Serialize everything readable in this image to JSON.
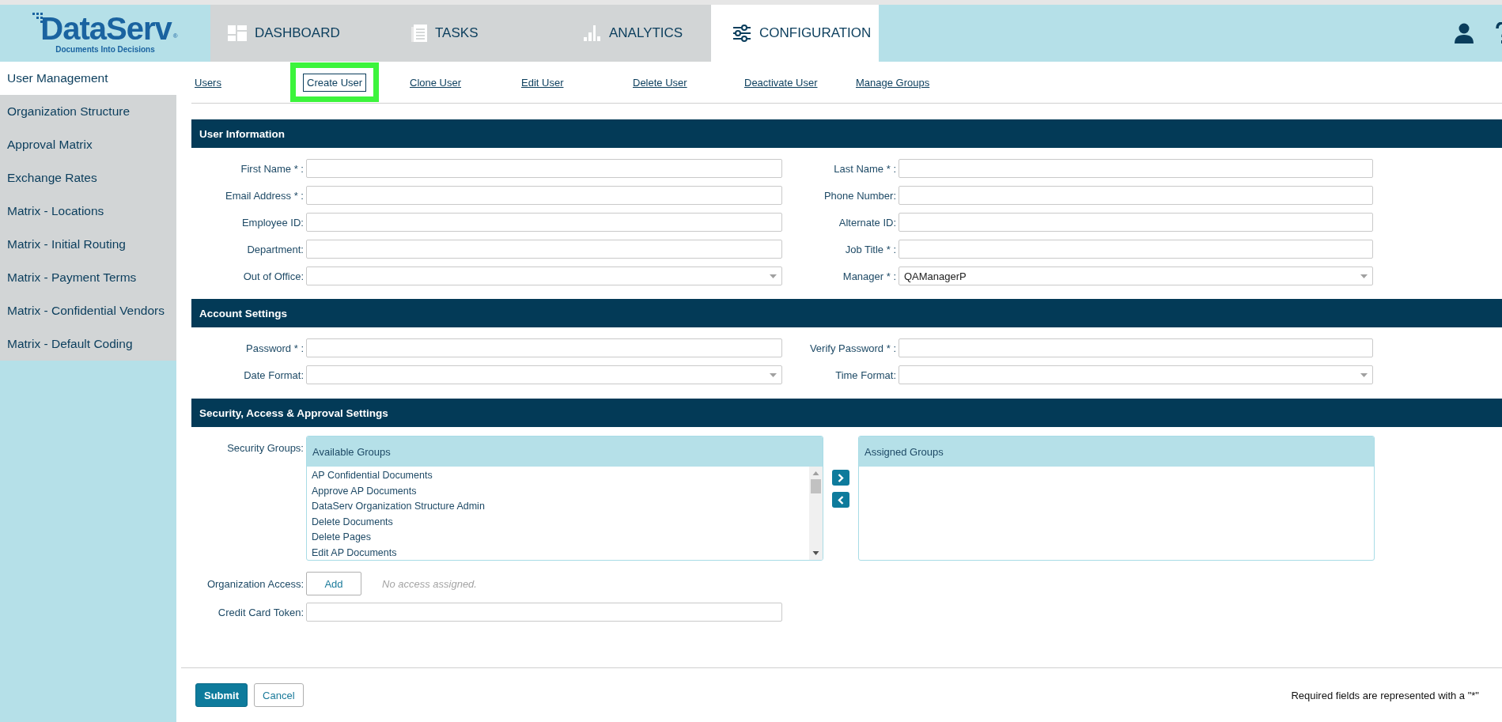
{
  "logo": {
    "name": "DataServ",
    "mark": "®",
    "tagline": "Documents Into Decisions"
  },
  "tabs": [
    {
      "label": "DASHBOARD",
      "selected": false
    },
    {
      "label": "TASKS",
      "selected": false
    },
    {
      "label": "ANALYTICS",
      "selected": false
    },
    {
      "label": "CONFIGURATION",
      "selected": true
    }
  ],
  "sidebar": {
    "items": [
      {
        "label": "User Management",
        "selected": true
      },
      {
        "label": "Organization Structure",
        "selected": false
      },
      {
        "label": "Approval Matrix",
        "selected": false
      },
      {
        "label": "Exchange Rates",
        "selected": false
      },
      {
        "label": "Matrix - Locations",
        "selected": false
      },
      {
        "label": "Matrix - Initial Routing",
        "selected": false
      },
      {
        "label": "Matrix - Payment Terms",
        "selected": false
      },
      {
        "label": "Matrix - Confidential Vendors",
        "selected": false
      },
      {
        "label": "Matrix - Default Coding",
        "selected": false
      }
    ]
  },
  "sub_nav": [
    {
      "label": "Users",
      "selected": false
    },
    {
      "label": "Create User",
      "selected": true
    },
    {
      "label": "Clone User",
      "selected": false
    },
    {
      "label": "Edit User",
      "selected": false
    },
    {
      "label": "Delete User",
      "selected": false
    },
    {
      "label": "Deactivate User",
      "selected": false
    },
    {
      "label": "Manage Groups",
      "selected": false
    }
  ],
  "user_information": {
    "title": "User Information",
    "fields": [
      {
        "label": "First Name * :",
        "kind": "text"
      },
      {
        "label": "Last Name * :",
        "kind": "text"
      },
      {
        "label": "Email Address * :",
        "kind": "text"
      },
      {
        "label": "Phone Number:",
        "kind": "text"
      },
      {
        "label": "Employee ID:",
        "kind": "text"
      },
      {
        "label": "Alternate ID:",
        "kind": "text"
      },
      {
        "label": "Department:",
        "kind": "text"
      },
      {
        "label": "Job Title * :",
        "kind": "text"
      },
      {
        "label": "Out of Office:",
        "kind": "select"
      },
      {
        "label": "Manager * :",
        "kind": "select",
        "value": "QAManagerP"
      }
    ]
  },
  "account_settings": {
    "title": "Account Settings",
    "fields": [
      {
        "label": "Password * :",
        "kind": "text"
      },
      {
        "label": "Verify Password * :",
        "kind": "text"
      },
      {
        "label": "Date Format:",
        "kind": "select"
      },
      {
        "label": "Time Format:",
        "kind": "select"
      }
    ]
  },
  "security": {
    "title": "Security, Access & Approval Settings",
    "security_groups": {
      "label": "Security Groups:",
      "available": {
        "title": "Available Groups",
        "items": [
          "AP Confidential Documents",
          "Approve AP Documents",
          "DataServ Organization Structure Admin",
          "Delete Documents",
          "Delete Pages",
          "Edit AP Documents"
        ]
      },
      "assigned": {
        "title": "Assigned Groups"
      }
    },
    "organization_access": {
      "label": "Organization Access:",
      "button": "Add",
      "note": "No access assigned."
    },
    "credit_card_token": {
      "label": "Credit Card Token:"
    }
  },
  "footer": {
    "buttons": [
      {
        "label": "Submit",
        "kind": "primary"
      },
      {
        "label": "Cancel",
        "kind": "secondary"
      }
    ],
    "note": "Required fields are represented with a \"*\""
  }
}
